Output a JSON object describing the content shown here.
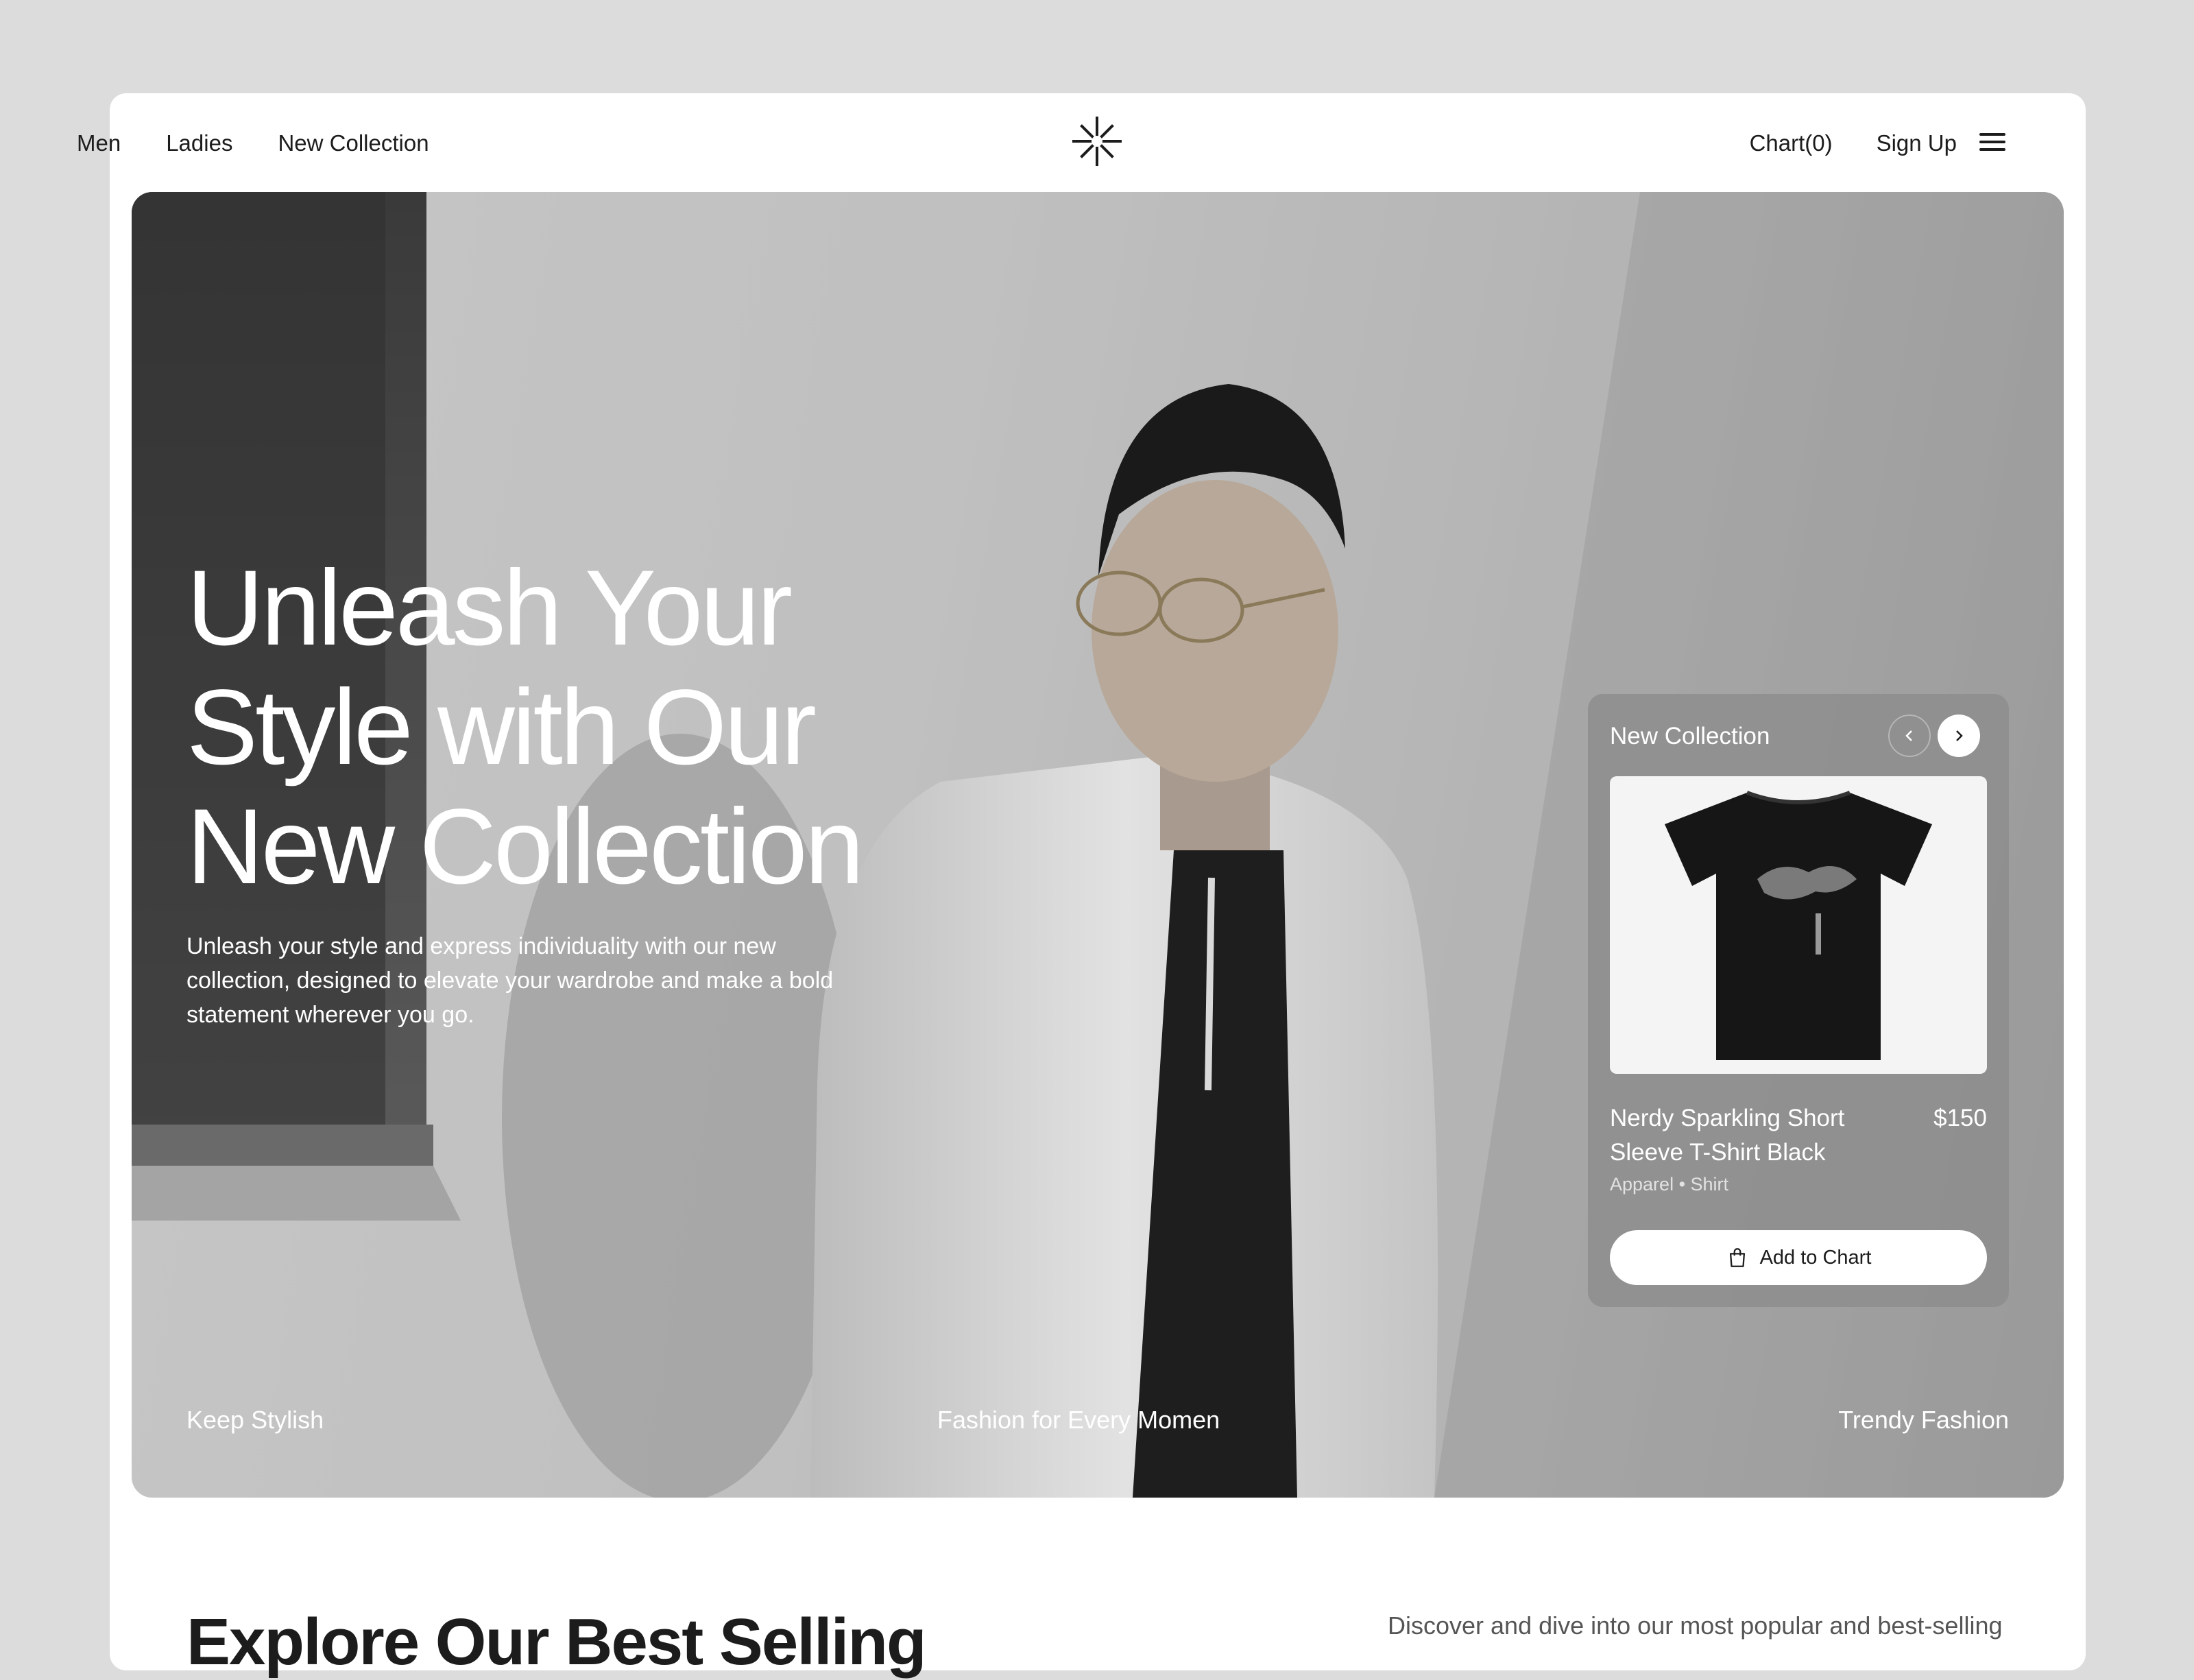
{
  "header": {
    "nav_left": [
      "Men",
      "Ladies",
      "New Collection"
    ],
    "logo_icon": "asterisk-star-logo",
    "cart_label": "Chart(0)",
    "signup_label": "Sign Up",
    "menu_icon": "hamburger-menu-icon"
  },
  "hero": {
    "title_lines": [
      "Unleash Your",
      "Style with Our",
      "New Collection"
    ],
    "description": "Unleash your style and express individuality with our new collection, designed to elevate your wardrobe and make a bold statement wherever you go.",
    "footer_left": "Keep Stylish",
    "footer_center": "Fashion for Every Momen",
    "footer_right": "Trendy Fashion"
  },
  "product_card": {
    "heading": "New Collection",
    "prev_icon": "chevron-left-icon",
    "next_icon": "chevron-right-icon",
    "image_icon": "black-tshirt-image",
    "name": "Nerdy Sparkling Short Sleeve T-Shirt Black",
    "price": "$150",
    "category": "Apparel • Shirt",
    "add_button_label": "Add to Chart",
    "add_button_icon": "shopping-bag-icon"
  },
  "section": {
    "heading": "Explore Our Best Selling",
    "description": "Discover and dive into our most popular and best-selling"
  },
  "colors": {
    "page_bg": "#dcdcdc",
    "card_bg": "#ffffff",
    "text_dark": "#1c1c1c",
    "hero_text": "#ffffff"
  }
}
